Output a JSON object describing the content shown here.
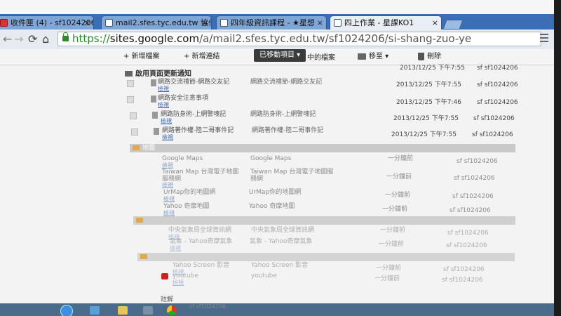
{
  "browser": {
    "tabs": [
      {
        "label": "收件匣 (4) - sf1024206@",
        "icon": "mail-icon",
        "active": false
      },
      {
        "label": "mail2.sfes.tyc.edu.tw 協作",
        "icon": "sites-icon",
        "active": false
      },
      {
        "label": "四年級資訊課程 - ★星想",
        "icon": "sites-icon",
        "active": false
      },
      {
        "label": "四上作業 - 星課KO1",
        "icon": "sites-icon",
        "active": true
      }
    ],
    "url": {
      "scheme": "https://",
      "host": "sites.google.com",
      "path": "/a/mail2.sfes.tyc.edu.tw/sf1024206/si-shang-zuo-ye"
    }
  },
  "sites_toolbar": {
    "new_file": "+ 新增檔案",
    "new_link": "+ 新增連結",
    "moved_items": "已移動項目",
    "moved_items_tail": "中的檔案",
    "move_to": "移至",
    "delete": "刪除"
  },
  "main": {
    "section_title": "啟用頁面更新通知",
    "top_rows": [
      {
        "name": "網路交流禮節-網路交友記",
        "view": "檢視",
        "desc": "網路交流禮節-網路交友記",
        "date": "2013/12/25 下午7:55",
        "owner": "sf sf1024206"
      },
      {
        "name": "網路安全注意事項",
        "view": "檢視",
        "desc": "",
        "date": "2013/12/25 下午7:46",
        "owner": "sf sf1024206"
      },
      {
        "name": "網路防身術-上網警魂記",
        "view": "檢視",
        "desc": "網路防身術-上網警魂記",
        "date": "2013/12/25 下午7:55",
        "owner": "sf sf1024206"
      },
      {
        "name": "網路著作權-陸二哥事件記",
        "view": "檢視",
        "desc": "網路著作權-陸二哥事件記",
        "date": "2013/12/25 下午7:55",
        "owner": "sf sf1024206"
      }
    ],
    "top_partial": {
      "date": "2013/12/25 下午7:55",
      "owner": "sf sf1024206"
    },
    "group1": {
      "label": "地圖",
      "rows": [
        {
          "name": "Google Maps",
          "view": "檢視",
          "desc": "Google Maps",
          "date": "一分鐘前",
          "owner": "sf sf1024206"
        },
        {
          "name": "Taiwan Map 台灣電子地圖服務網",
          "view": "檢視",
          "desc": "Taiwan Map 台灣電子地圖服務網",
          "date": "一分鐘前",
          "owner": "sf sf1024206"
        },
        {
          "name": "UrMap你的地圖網",
          "view": "檢視",
          "desc": "UrMap你的地圖網",
          "date": "一分鐘前",
          "owner": "sf sf1024206"
        },
        {
          "name": "Yahoo 奇摩地圖",
          "view": "檢視",
          "desc": "Yahoo 奇摩地圖",
          "date": "一分鐘前",
          "owner": "sf sf1024206"
        }
      ]
    },
    "group2": {
      "label": "",
      "rows": [
        {
          "name": "中央氣象局全球資訊網",
          "view": "檢視",
          "desc": "中央氣象局全球資訊網",
          "date": "一分鐘前",
          "owner": "sf sf1024206"
        },
        {
          "name": "氣象 - Yahoo奇摩氣象",
          "view": "檢視",
          "desc": "氣象 - Yahoo奇摩氣象",
          "date": "一分鐘前",
          "owner": "sf sf1024206"
        }
      ]
    },
    "group3": {
      "label": "",
      "rows": [
        {
          "name": "Yahoo Screen 影音",
          "view": "檢視",
          "desc": "Yahoo Screen 影音",
          "date": "一分鐘前",
          "owner": "sf sf1024206"
        },
        {
          "name": "youtube",
          "view": "檢視",
          "desc": "youtube",
          "date": "一分鐘前",
          "owner": "sf sf1024206"
        }
      ]
    },
    "notes_title": "註解",
    "notes_user": "sf sf1024206"
  }
}
